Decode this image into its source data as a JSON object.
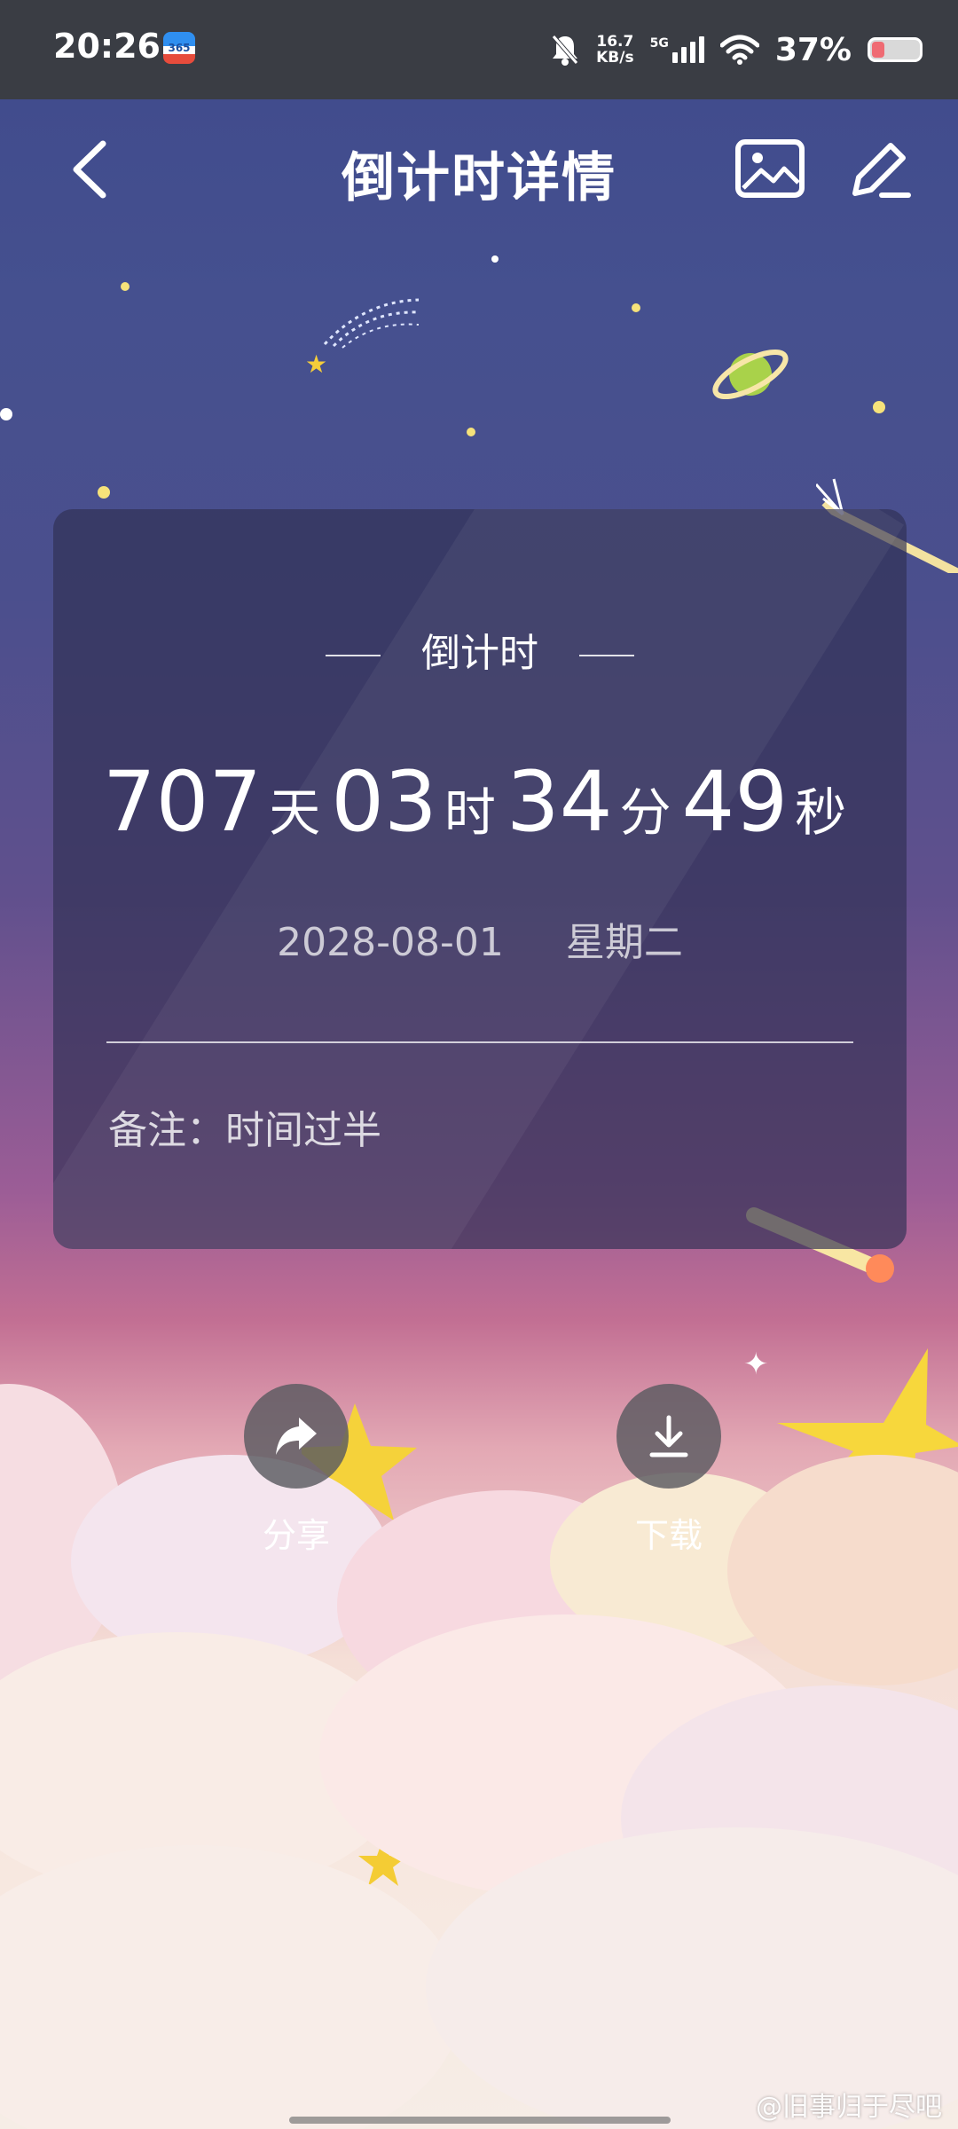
{
  "status_bar": {
    "time": "20:26",
    "app_icon_text": "365",
    "net_speed_value": "16.7",
    "net_speed_unit": "KB/s",
    "signal_label": "5G",
    "battery_percent": "37%"
  },
  "header": {
    "title": "倒计时详情"
  },
  "card": {
    "label": "倒计时",
    "countdown": {
      "days": "707",
      "days_unit": "天",
      "hours": "03",
      "hours_unit": "时",
      "minutes": "34",
      "minutes_unit": "分",
      "seconds": "49",
      "seconds_unit": "秒"
    },
    "target_date": "2028-08-01",
    "weekday": "星期二",
    "note_label": "备注：",
    "note_text": "时间过半"
  },
  "actions": {
    "share_label": "分享",
    "download_label": "下载"
  },
  "watermark": "@旧事归于尽吧",
  "colors": {
    "status_bar_bg": "#3a3d44",
    "sky_top": "#3f4a8c",
    "sky_pink": "#c26f93",
    "card_bg": "rgba(48,48,84,0.68)",
    "star_yellow": "#f5cd3a"
  },
  "icons": {
    "back": "chevron-left-icon",
    "image": "image-icon",
    "edit": "pencil-icon",
    "share": "share-arrow-icon",
    "download": "download-icon",
    "mute": "bell-off-icon",
    "signal": "signal-bars-icon",
    "wifi": "wifi-icon",
    "battery": "battery-icon"
  }
}
